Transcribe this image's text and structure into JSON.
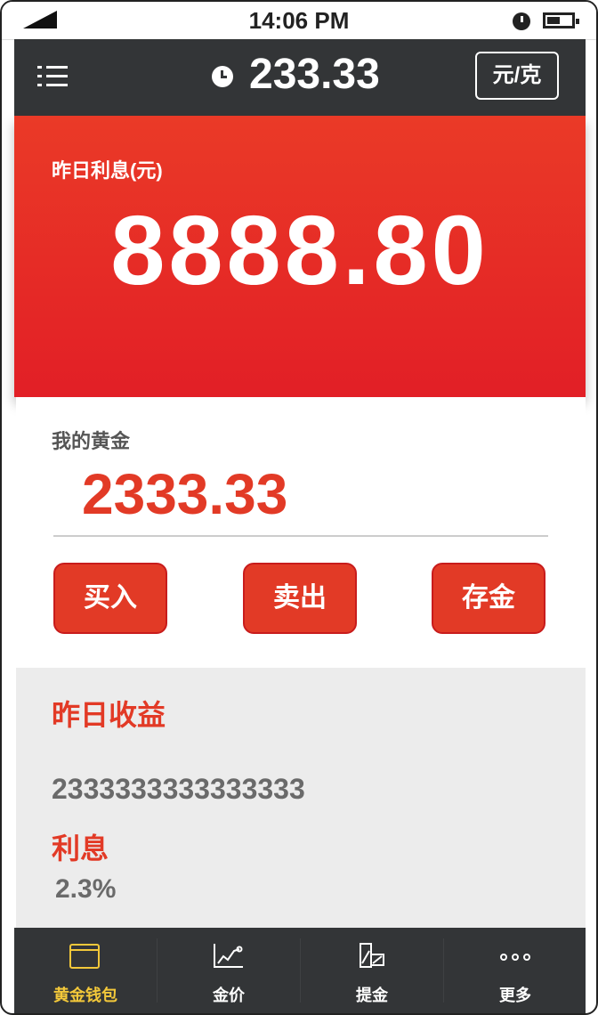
{
  "status": {
    "time": "14:06 PM"
  },
  "header": {
    "price": "233.33",
    "unit_button": "元/克"
  },
  "hero": {
    "label": "昨日利息(元)",
    "value": "8888.80"
  },
  "gold": {
    "label": "我的黄金",
    "value": "2333.33",
    "actions": [
      "买入",
      "卖出",
      "存金"
    ]
  },
  "earnings": {
    "title": "昨日收益",
    "value": "2333333333333333",
    "interest_title": "利息",
    "interest_value": "2.3%"
  },
  "tabs": [
    {
      "label": "黄金钱包",
      "icon": "wallet-icon",
      "active": true
    },
    {
      "label": "金价",
      "icon": "chart-icon",
      "active": false
    },
    {
      "label": "提金",
      "icon": "withdraw-icon",
      "active": false
    },
    {
      "label": "更多",
      "icon": "more-icon",
      "active": false
    }
  ],
  "colors": {
    "accent": "#e23a26",
    "active_tab": "#f3c83a",
    "bar": "#333537"
  }
}
